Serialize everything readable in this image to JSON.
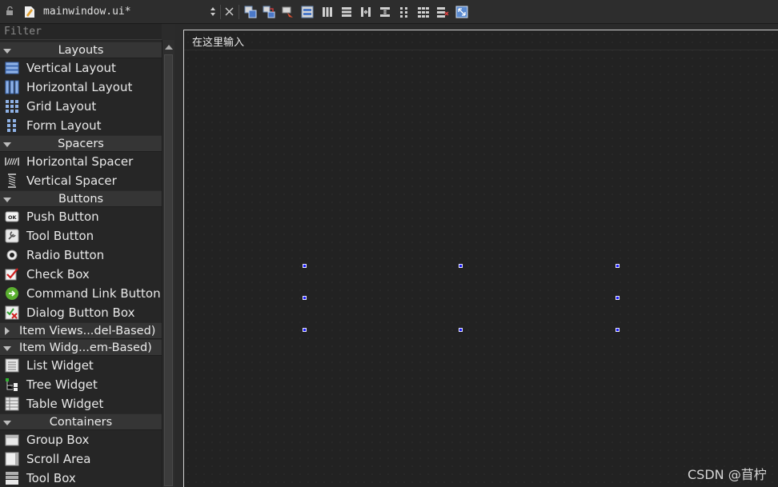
{
  "toolbar": {
    "file_name": "mainwindow.ui*",
    "icons": [
      "edit-widgets-icon",
      "edit-signals-icon",
      "edit-buddies-icon",
      "edit-tab-order-icon",
      "layout-horizontal-icon",
      "layout-vertical-icon",
      "layout-horizontal-splitter-icon",
      "layout-vertical-splitter-icon",
      "layout-form-icon",
      "layout-grid-icon",
      "break-layout-icon",
      "adjust-size-icon"
    ]
  },
  "widget_box": {
    "filter_placeholder": "Filter",
    "categories": {
      "layouts": "Layouts",
      "spacers": "Spacers",
      "buttons": "Buttons",
      "item_views": "Item Views...del-Based)",
      "item_widgets": "Item Widg...em-Based)",
      "containers": "Containers"
    },
    "items": {
      "vertical_layout": "Vertical Layout",
      "horizontal_layout": "Horizontal Layout",
      "grid_layout": "Grid Layout",
      "form_layout": "Form Layout",
      "horizontal_spacer": "Horizontal Spacer",
      "vertical_spacer": "Vertical Spacer",
      "push_button": "Push Button",
      "tool_button": "Tool Button",
      "radio_button": "Radio Button",
      "check_box": "Check Box",
      "command_link_button": "Command Link Button",
      "dialog_button_box": "Dialog Button Box",
      "list_widget": "List Widget",
      "tree_widget": "Tree Widget",
      "table_widget": "Table Widget",
      "group_box": "Group Box",
      "scroll_area": "Scroll Area",
      "tool_box": "Tool Box"
    }
  },
  "form": {
    "menu_placeholder": "在这里输入"
  },
  "watermark": "CSDN @苜柠",
  "colors": {
    "selection_handle": "#1c1cff",
    "panel_bg": "#262626",
    "category_bg": "#353535",
    "form_bg": "#222222"
  }
}
